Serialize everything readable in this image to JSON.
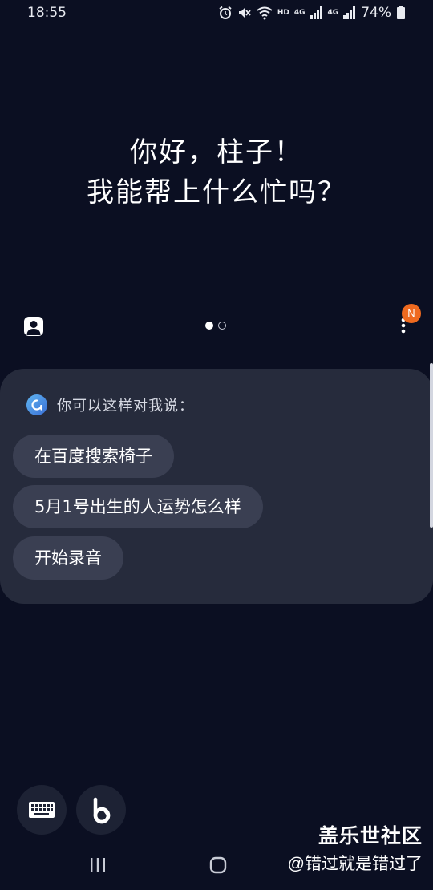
{
  "status_bar": {
    "time": "18:55",
    "battery_percent": "74%",
    "hd_label": "HD",
    "network_label": "4G",
    "icons": [
      "alarm-icon",
      "mute-icon",
      "wifi-icon",
      "signal-icon",
      "battery-icon"
    ]
  },
  "greeting": {
    "line1": "你好，柱子！",
    "line2": "我能帮上什么忙吗？"
  },
  "pager": {
    "pages": 2,
    "active_page": 1
  },
  "menu": {
    "badge": "N"
  },
  "suggestions": {
    "title": "你可以这样对我说：",
    "items": [
      "在百度搜索椅子",
      "5月1号出生的人运势怎么样",
      "开始录音"
    ]
  },
  "watermark": {
    "brand": "盖乐世社区",
    "user": "@错过就是错过了"
  },
  "colors": {
    "background": "#0b0f22",
    "card": "#262b3c",
    "chip": "#3a3f52",
    "badge": "#ef6a1f",
    "bixby_accent": "#4a8ee0"
  }
}
